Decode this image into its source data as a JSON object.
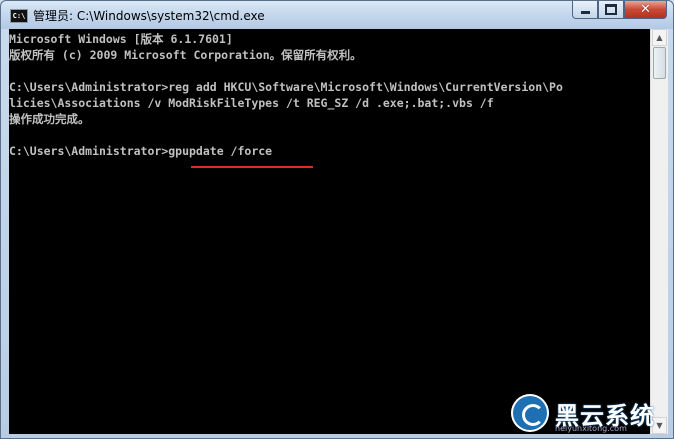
{
  "window": {
    "title": "管理员: C:\\Windows\\system32\\cmd.exe",
    "app_icon_text": "C:\\",
    "minimize_icon": "minimize-icon",
    "maximize_icon": "maximize-icon",
    "close_label": "✕"
  },
  "console": {
    "lines": [
      "Microsoft Windows [版本 6.1.7601]",
      "版权所有 (c) 2009 Microsoft Corporation。保留所有权利。",
      "",
      "C:\\Users\\Administrator>reg add HKCU\\Software\\Microsoft\\Windows\\CurrentVersion\\Po",
      "licies\\Associations /v ModRiskFileTypes /t REG_SZ /d .exe;.bat;.vbs /f",
      "操作成功完成。",
      "",
      "C:\\Users\\Administrator>gpupdate /force"
    ]
  },
  "scrollbar": {
    "up": "▲",
    "down": "▼"
  },
  "watermark": {
    "text": "黑云系统",
    "sub": "heiyunxitong.com"
  }
}
